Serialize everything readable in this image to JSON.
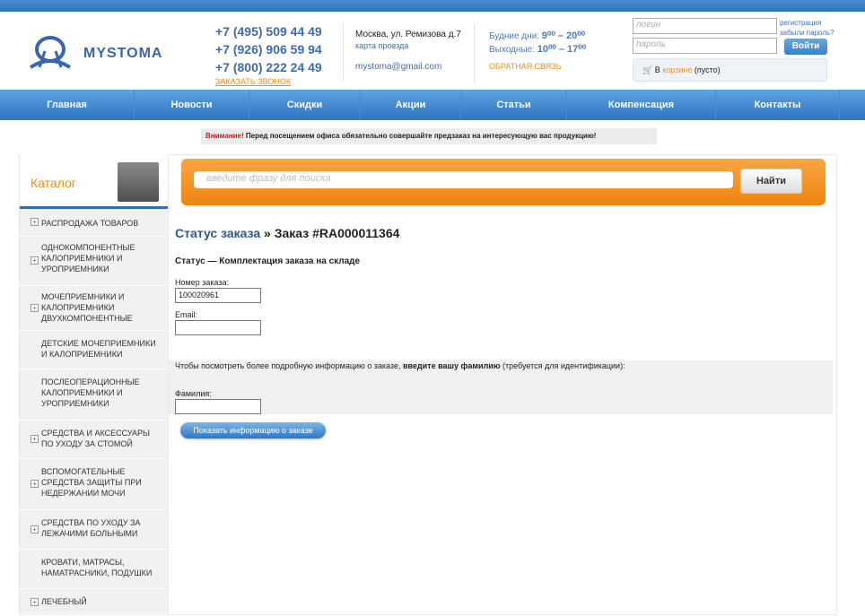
{
  "header": {
    "logo_text": "MYSTOMA",
    "phones": [
      "+7 (495) 509 44 49",
      "+7 (926) 906 59 94",
      "+7 (800) 222 24 49"
    ],
    "callback_link": "ЗАКАЗАТЬ ЗВОНОК",
    "address": "Москва, ул. Ремизова д.7",
    "map_link": "карта проезда",
    "email": "mystoma@gmail.com",
    "weekdays_label": "Будние дни:",
    "weekdays_hours": "9⁰⁰ – 20⁰⁰",
    "weekend_label": "Выходные:",
    "weekend_hours": "10⁰⁰ – 17⁰⁰",
    "feedback_link": "ОБРАТНАЯ СВЯЗЬ",
    "login_placeholder": "логин",
    "password_placeholder": "пароль",
    "register_link": "регистрация",
    "forgot_link": "забыли пароль?",
    "login_button": "Войти",
    "cart_prefix": "В",
    "cart_link": "корзине",
    "cart_status": "(пусто)"
  },
  "nav": [
    "Главная",
    "Новости",
    "Скидки",
    "Акции",
    "Статьи",
    "Компенсация",
    "Контакты"
  ],
  "notice": {
    "warn": "Внимание!",
    "text": "Перед посещением офиса обязательно совершайте предзаказ на интересующую вас продукцию!"
  },
  "catalog": {
    "title": "Каталог",
    "items": [
      {
        "label": "РАСПРОДАЖА ТОВАРОВ",
        "expandable": true
      },
      {
        "label": "ОДНОКОМПОНЕНТНЫЕ КАЛОПРИЕМНИКИ И УРОПРИЕМНИКИ",
        "expandable": true
      },
      {
        "label": "МОЧЕПРИЕМНИКИ И КАЛОПРИЕМНИКИ ДВУХКОМПОНЕНТНЫЕ",
        "expandable": true
      },
      {
        "label": "ДЕТСКИЕ МОЧЕПРИЕМНИКИ И КАЛОПРИЕМНИКИ",
        "expandable": false
      },
      {
        "label": "ПОСЛЕОПЕРАЦИОННЫЕ КАЛОПРИЕМНИКИ И УРОПРИЕМНИКИ",
        "expandable": false
      },
      {
        "label": "СРЕДСТВА И АКСЕССУАРЫ ПО УХОДУ ЗА СТОМОЙ",
        "expandable": true
      },
      {
        "label": "ВСПОМОГАТЕЛЬНЫЕ СРЕДСТВА ЗАЩИТЫ ПРИ НЕДЕРЖАНИИ МОЧИ",
        "expandable": true
      },
      {
        "label": "СРЕДСТВА ПО УХОДУ ЗА ЛЕЖАЧИМИ БОЛЬНЫМИ",
        "expandable": true
      },
      {
        "label": "КРОВАТИ, МАТРАСЫ, НАМАТРАСНИКИ, ПОДУШКИ",
        "expandable": false
      },
      {
        "label": "ЛЕЧЕБНЫЙ",
        "expandable": true
      }
    ]
  },
  "search": {
    "placeholder": "введите фразу для поиска",
    "button": "Найти"
  },
  "order": {
    "status_link": "Статус заказа",
    "title_rest": " » Заказ #RA000011364",
    "status_text": "Статус — Комплектация заказа на складе",
    "order_number_label": "Номер заказа:",
    "order_number_value": "100020961",
    "email_label": "Email:",
    "email_value": "",
    "info_prefix": "Чтобы посмотреть более подробную информацию о заказе, ",
    "info_bold": "введите вашу фамилию",
    "info_suffix": " (требуется для идентификации):",
    "surname_label": "Фамилия:",
    "surname_value": "",
    "show_button": "Показать информацию о заказе"
  }
}
